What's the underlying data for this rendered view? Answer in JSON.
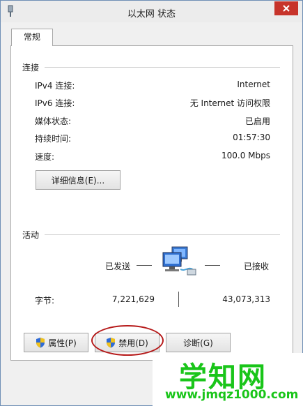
{
  "window": {
    "title": "以太网 状态"
  },
  "tab": {
    "label": "常规"
  },
  "connection": {
    "title": "连接",
    "rows": [
      {
        "label": "IPv4 连接:",
        "value": "Internet"
      },
      {
        "label": "IPv6 连接:",
        "value": "无 Internet 访问权限"
      },
      {
        "label": "媒体状态:",
        "value": "已启用"
      },
      {
        "label": "持续时间:",
        "value": "01:57:30"
      },
      {
        "label": "速度:",
        "value": "100.0 Mbps"
      }
    ],
    "details_button": "详细信息(E)..."
  },
  "activity": {
    "title": "活动",
    "sent_label": "已发送",
    "received_label": "已接收",
    "bytes_label": "字节:",
    "bytes_sent": "7,221,629",
    "bytes_received": "43,073,313"
  },
  "buttons": {
    "properties": "属性(P)",
    "disable": "禁用(D)",
    "diagnose": "诊断(G)"
  },
  "watermark": {
    "brand": "学知网",
    "url": "www.jmqz1000.com"
  },
  "icons": {
    "app": "network-adapter-icon",
    "close": "close-icon",
    "network": "network-computer-icon",
    "shield": "uac-shield-icon"
  },
  "colors": {
    "close_button": "#c7342b",
    "annotation_circle": "#b61a1a",
    "watermark": "#19c519"
  }
}
